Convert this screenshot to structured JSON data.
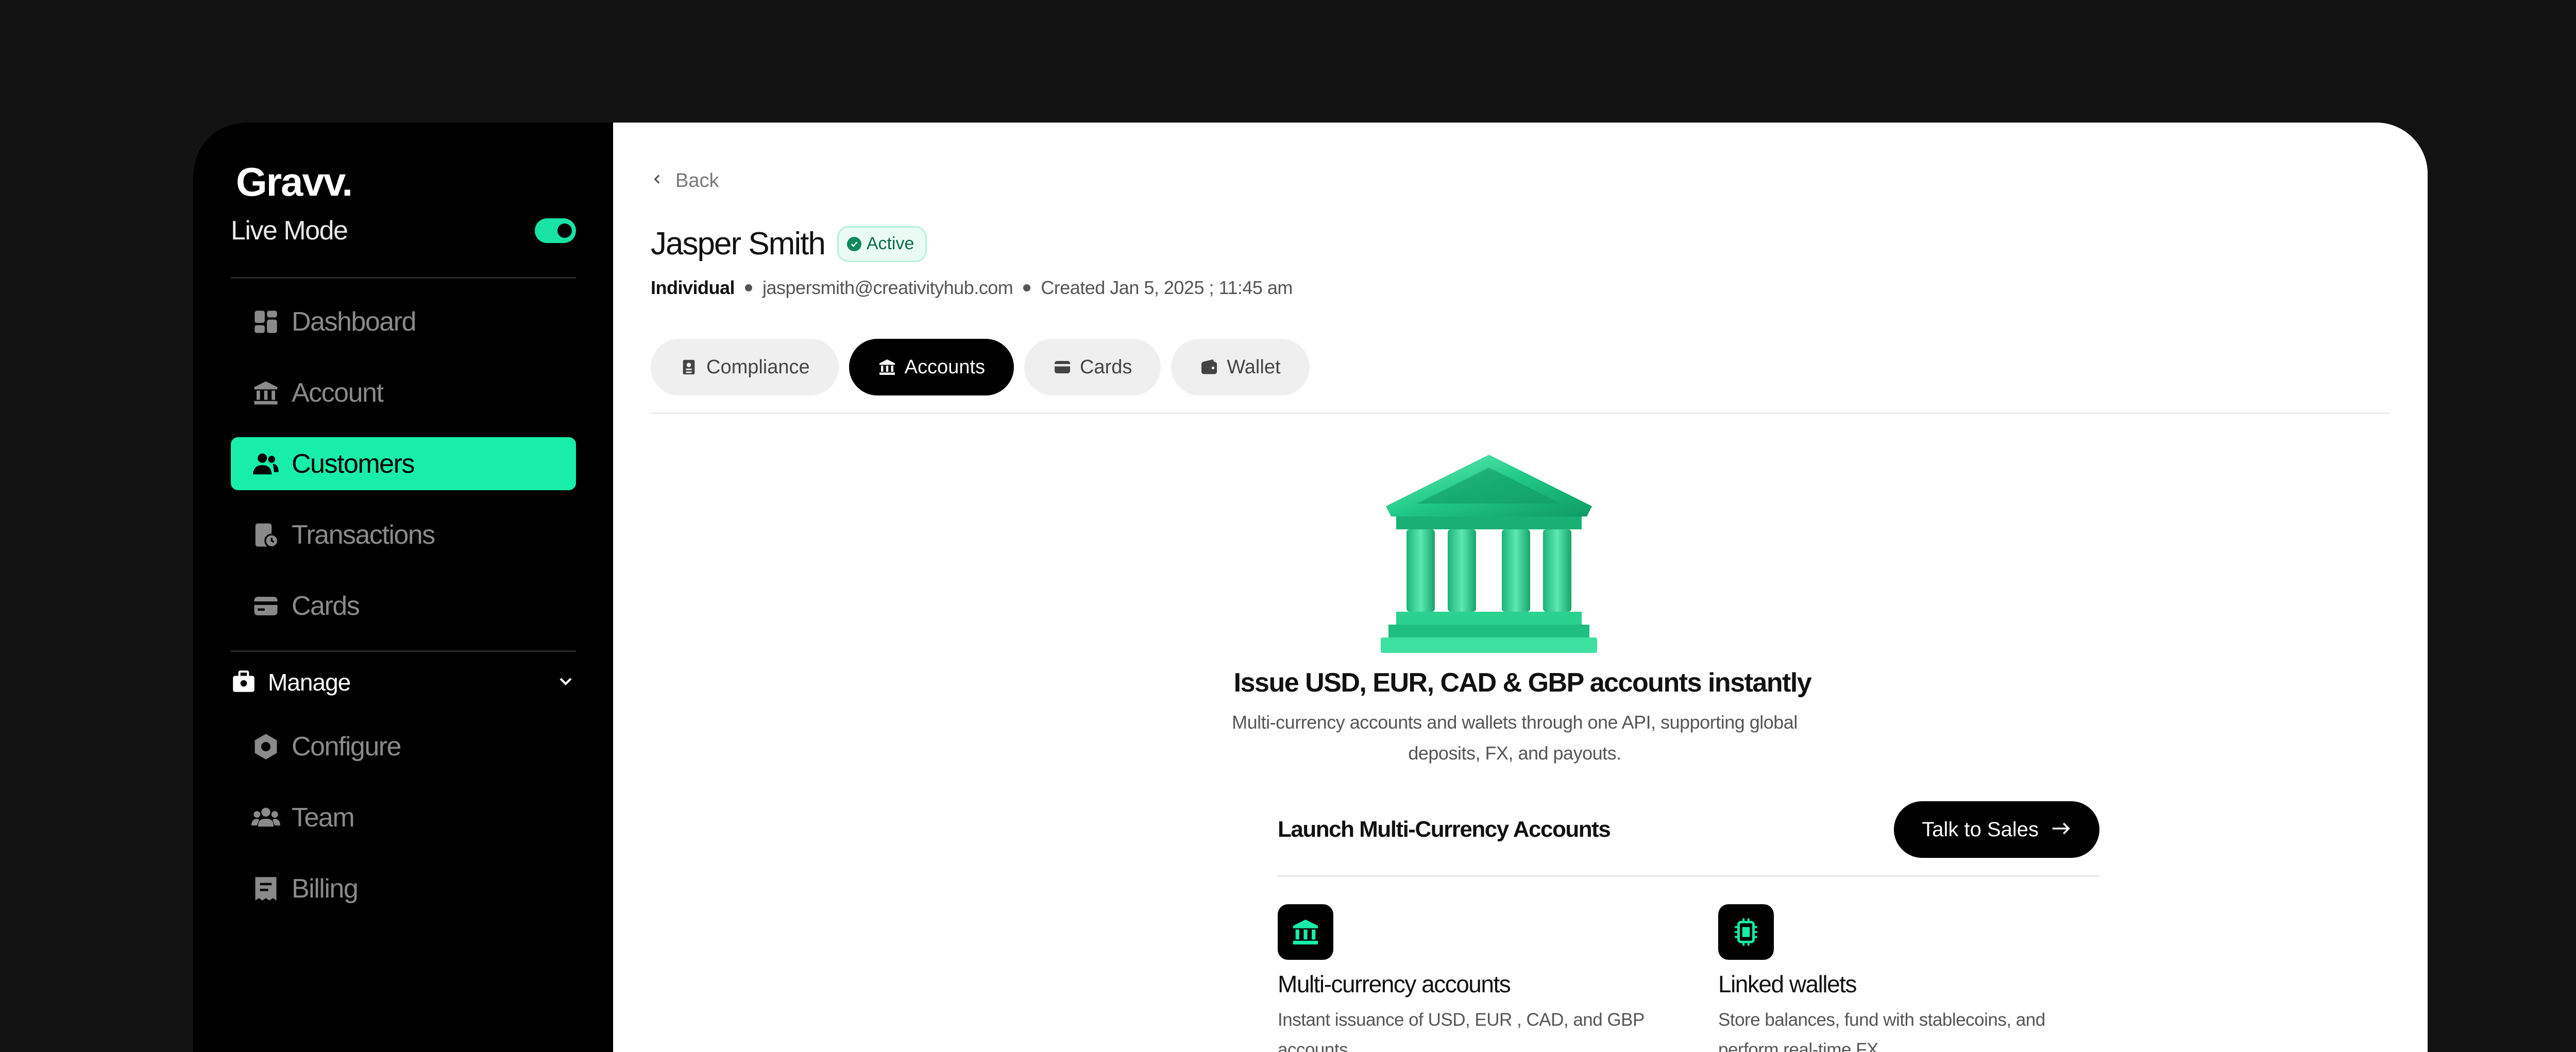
{
  "brand": {
    "name": "Gravv."
  },
  "sidebar": {
    "mode_label": "Live Mode",
    "items": [
      {
        "label": "Dashboard",
        "icon": "dashboard-icon"
      },
      {
        "label": "Account",
        "icon": "bank-icon"
      },
      {
        "label": "Customers",
        "icon": "customers-icon",
        "active": true
      },
      {
        "label": "Transactions",
        "icon": "transactions-icon"
      },
      {
        "label": "Cards",
        "icon": "card-icon"
      }
    ],
    "manage_label": "Manage",
    "manage_items": [
      {
        "label": "Configure",
        "icon": "configure-icon"
      },
      {
        "label": "Team",
        "icon": "team-icon"
      },
      {
        "label": "Billing",
        "icon": "billing-icon"
      }
    ]
  },
  "header": {
    "back_label": "Back",
    "customer_name": "Jasper Smith",
    "status": "Active",
    "type": "Individual",
    "email": "jaspersmith@creativityhub.com",
    "created": "Created Jan 5, 2025 ; 11:45 am"
  },
  "tabs": [
    {
      "label": "Compliance",
      "icon": "id-card-icon"
    },
    {
      "label": "Accounts",
      "icon": "bank-icon",
      "active": true
    },
    {
      "label": "Cards",
      "icon": "card-icon"
    },
    {
      "label": "Wallet",
      "icon": "wallet-icon"
    }
  ],
  "hero": {
    "title": "Issue USD, EUR, CAD & GBP accounts instantly",
    "subtitle": "Multi-currency accounts and wallets through one API, supporting global deposits, FX, and payouts."
  },
  "launch": {
    "title": "Launch Multi-Currency Accounts",
    "button_label": "Talk to Sales"
  },
  "features": [
    {
      "title": "Multi-currency accounts",
      "description": "Instant issuance of USD, EUR , CAD, and GBP accounts"
    },
    {
      "title": "Linked wallets",
      "description": "Store balances, fund with stablecoins, and perform real-time FX"
    }
  ],
  "colors": {
    "accent": "#19eea8",
    "sidebar_bg": "#000000",
    "page_bg": "#121212"
  }
}
